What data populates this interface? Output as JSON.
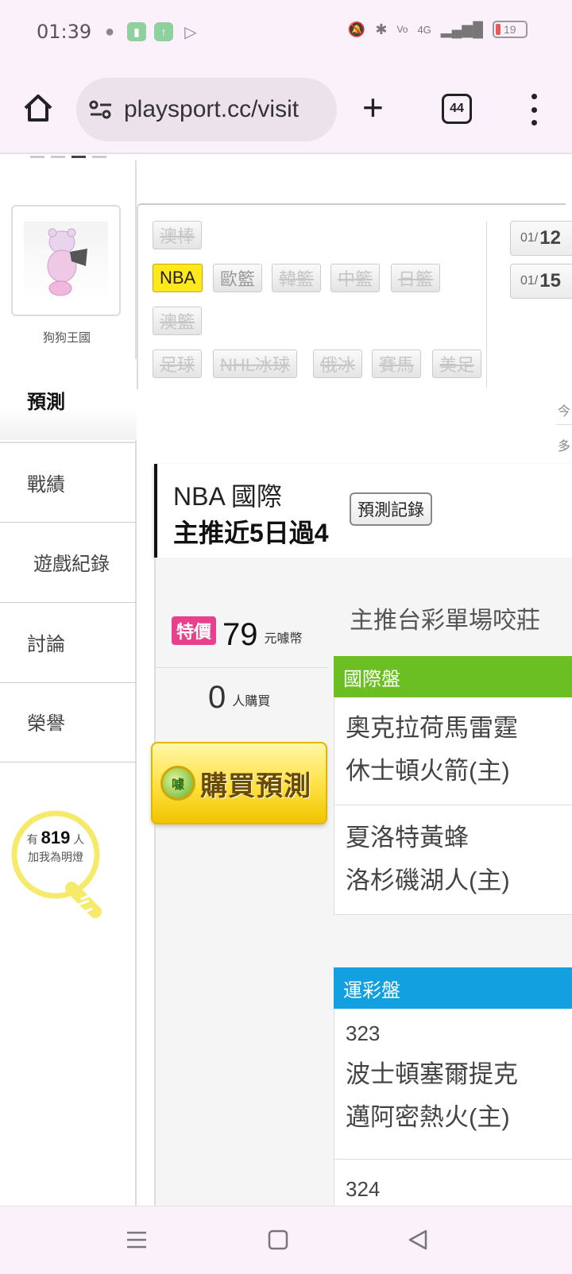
{
  "status_bar": {
    "time": "01:39",
    "battery": "19",
    "network": "4G"
  },
  "browser": {
    "url": "playsport.cc/visit",
    "tab_count": "44"
  },
  "profile": {
    "name": "狗狗王國"
  },
  "nav": {
    "items": [
      "預測",
      "戰績",
      "遊戲紀錄",
      "討論",
      "榮譽"
    ]
  },
  "fans": {
    "prefix": "有",
    "count": "819",
    "unit": "人",
    "label": "加我為明燈"
  },
  "categories": {
    "row1": [
      "澳棒"
    ],
    "row2": [
      "NBA",
      "歐籃",
      "韓籃",
      "中籃",
      "日籃"
    ],
    "row3": [
      "澳籃"
    ],
    "row4": [
      "足球",
      "NHL冰球",
      "俄冰",
      "賽馬",
      "美足"
    ],
    "active": "NBA"
  },
  "dates": {
    "d1_prefix": "01/",
    "d1_day": "12",
    "d2_prefix": "01/",
    "d2_day": "15"
  },
  "side_notes": [
    "今",
    "多"
  ],
  "header": {
    "title": "NBA 國際",
    "subtitle": "主推近5日過4",
    "record_button": "預測記錄"
  },
  "purchase": {
    "tag": "特價",
    "price": "79",
    "price_unit": "元噱幣",
    "buyers": "0",
    "buyers_unit": "人購買",
    "buy_button": "購買預測",
    "coin_label": "噱"
  },
  "main": {
    "heading": "主推台彩單場咬莊"
  },
  "sections": {
    "intl": {
      "title": "國際盤",
      "games": [
        [
          "奧克拉荷馬雷霆",
          "休士頓火箭(主)"
        ],
        [
          "夏洛特黃蜂",
          "洛杉磯湖人(主)"
        ]
      ]
    },
    "sports_lottery": {
      "title": "運彩盤",
      "games": [
        {
          "no": "323",
          "teams": [
            "波士頓塞爾提克",
            "邁阿密熱火(主)"
          ]
        },
        {
          "no": "324"
        }
      ]
    }
  },
  "colors": {
    "intl_header": "#6bbf22",
    "lottery_header": "#13a0e0",
    "special_tag": "#e8408c",
    "active_category": "#ffe81b"
  }
}
